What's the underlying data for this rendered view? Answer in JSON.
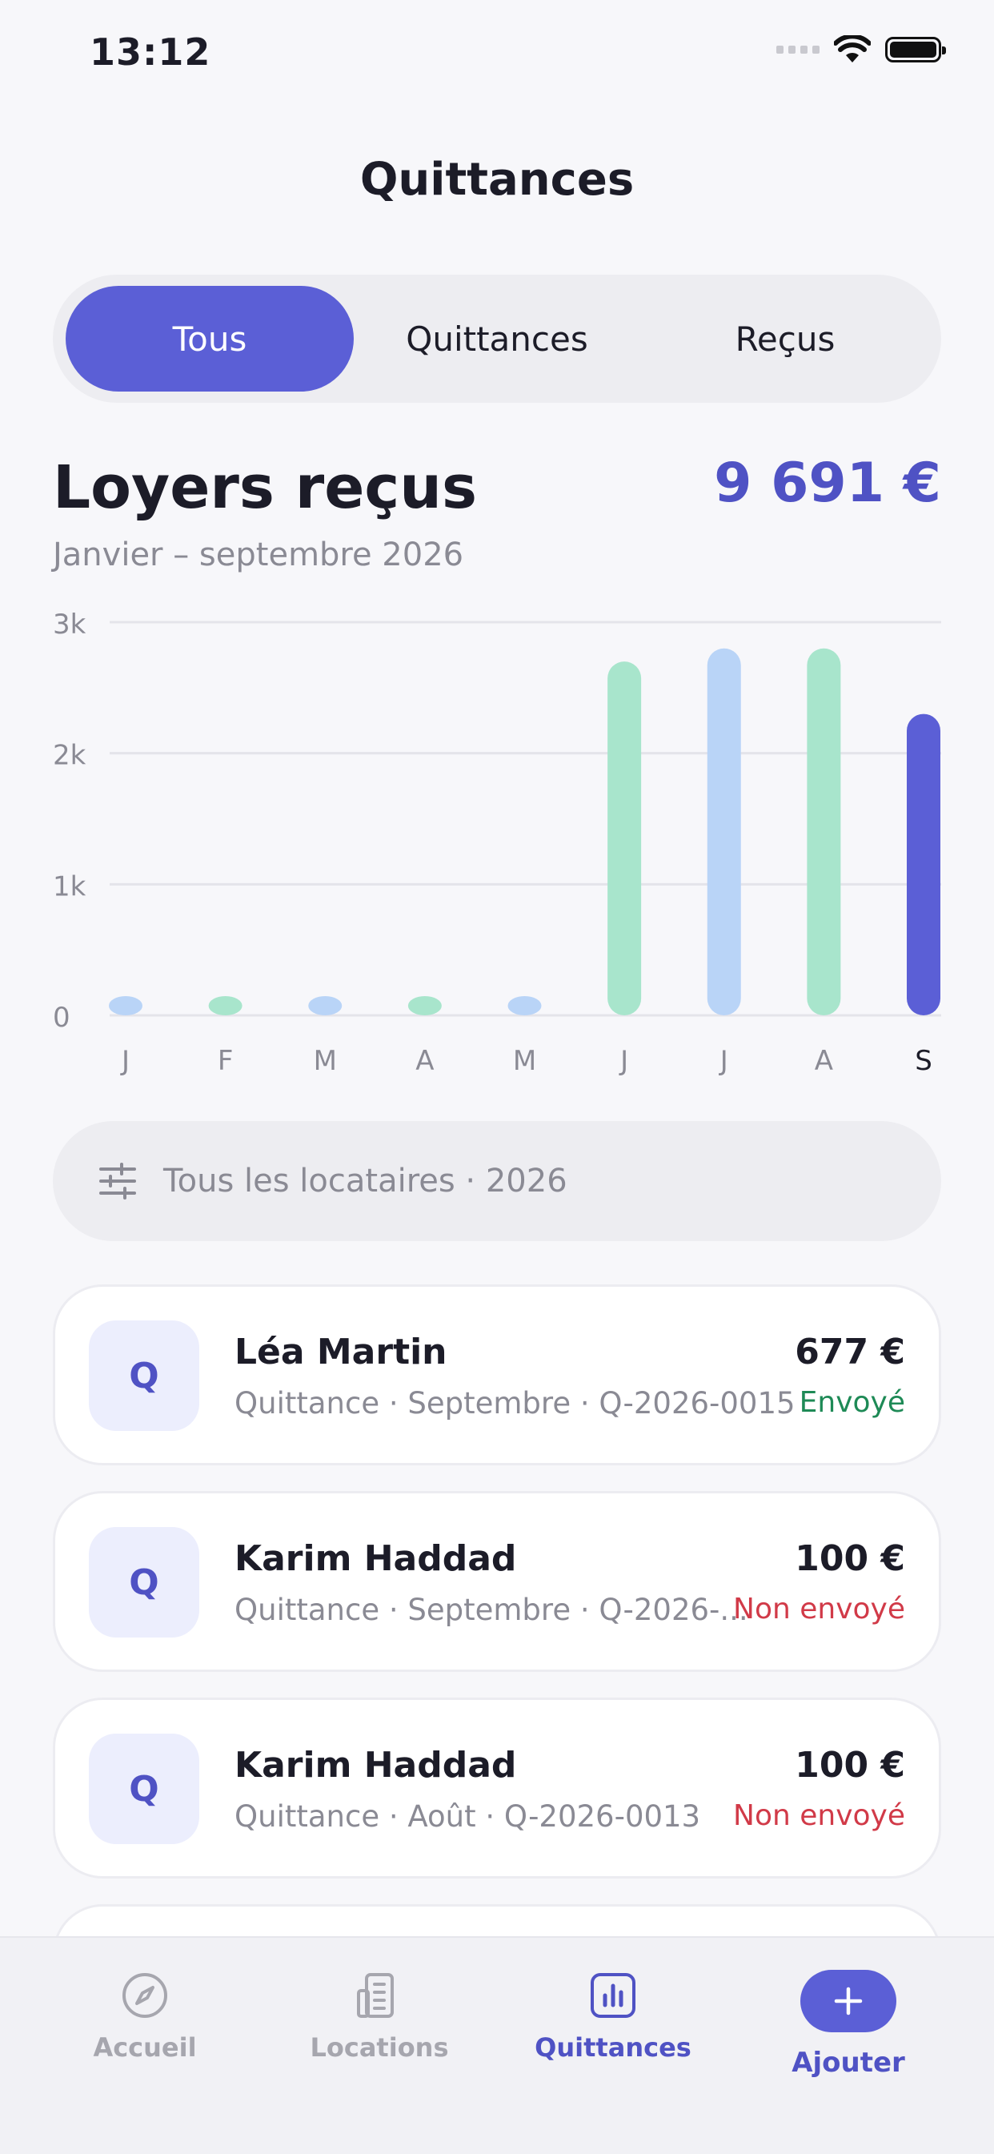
{
  "status_bar": {
    "time": "13:12"
  },
  "header": {
    "title": "Quittances"
  },
  "segments": [
    {
      "label": "Tous",
      "active": true
    },
    {
      "label": "Quittances",
      "active": false
    },
    {
      "label": "Reçus",
      "active": false
    }
  ],
  "summary": {
    "title": "Loyers reçus",
    "period": "Janvier – septembre 2026",
    "total": "9 691 €"
  },
  "chart_data": {
    "type": "bar",
    "categories": [
      "J",
      "F",
      "M",
      "A",
      "M",
      "J",
      "J",
      "A",
      "S"
    ],
    "values": [
      0,
      0,
      0,
      0,
      0,
      2700,
      2800,
      2800,
      2300
    ],
    "y_tick_labels": [
      "0",
      "1k",
      "2k",
      "3k"
    ],
    "ylim": [
      0,
      3000
    ],
    "grid": true,
    "bar_colors": [
      "#b9d4f7",
      "#a8e5cc",
      "#b9d4f7",
      "#a8e5cc",
      "#b9d4f7",
      "#a8e5cc",
      "#b9d4f7",
      "#a8e5cc",
      "#5b5fd6"
    ]
  },
  "filter": {
    "label": "Tous les locataires · 2026",
    "icon": "sliders-icon"
  },
  "receipts": [
    {
      "badge": "Q",
      "name": "Léa Martin",
      "detail": "Quittance · Septembre · Q-2026-0015",
      "amount": "677 €",
      "status": "Envoyé",
      "status_type": "sent"
    },
    {
      "badge": "Q",
      "name": "Karim Haddad",
      "detail": "Quittance · Septembre · Q-2026-...",
      "amount": "100 €",
      "status": "Non envoyé",
      "status_type": "notsent"
    },
    {
      "badge": "Q",
      "name": "Karim Haddad",
      "detail": "Quittance · Août · Q-2026-0013",
      "amount": "100 €",
      "status": "Non envoyé",
      "status_type": "notsent"
    }
  ],
  "tabbar": {
    "items": [
      {
        "label": "Accueil",
        "icon": "compass-icon"
      },
      {
        "label": "Locations",
        "icon": "building-icon"
      },
      {
        "label": "Quittances",
        "icon": "chart-icon",
        "active": true
      },
      {
        "label": "Ajouter",
        "icon": "plus-icon"
      }
    ]
  },
  "colors": {
    "accent": "#5b5fd6",
    "sent": "#1e8a56",
    "not_sent": "#d13a48"
  }
}
